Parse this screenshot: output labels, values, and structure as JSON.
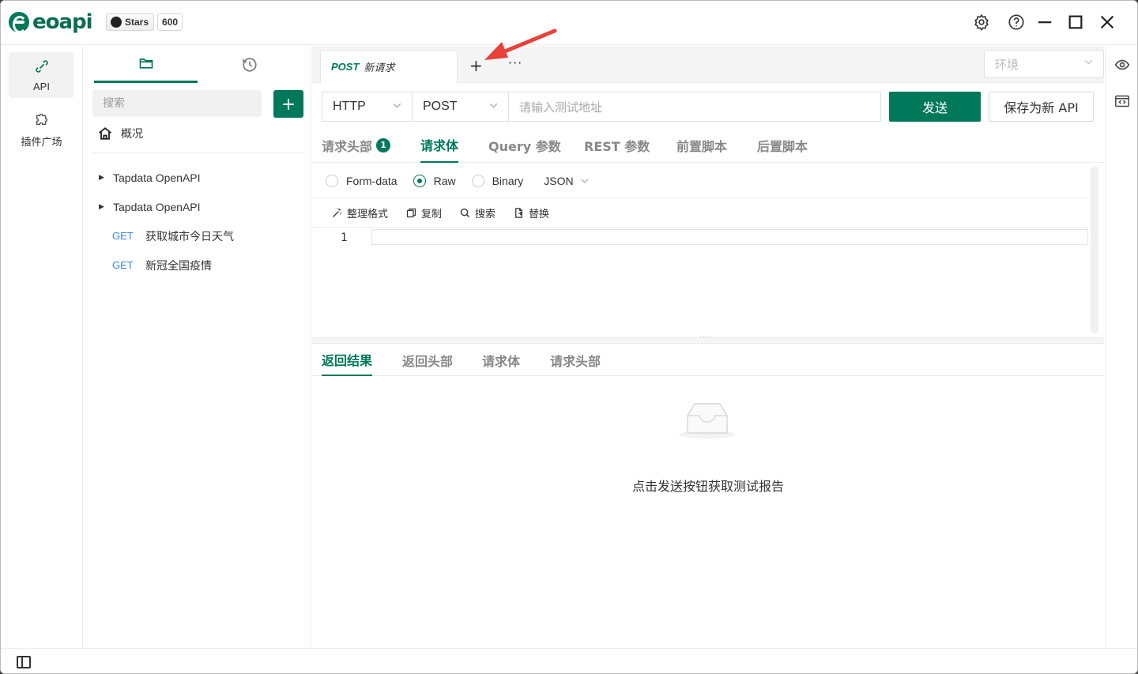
{
  "app": {
    "logo_text": "eoapi",
    "github": {
      "stars_label": "Stars",
      "stars_count": "600"
    },
    "brand_color": "#00785a"
  },
  "window_controls": [
    "settings-icon",
    "help-icon",
    "minimize-icon",
    "maximize-icon",
    "close-icon"
  ],
  "rail": {
    "items": [
      {
        "label": "API",
        "icon": "api-icon",
        "active": true
      },
      {
        "label": "插件广场",
        "icon": "plugin-icon",
        "active": false
      }
    ]
  },
  "sidebar": {
    "tabs": [
      {
        "icon": "folder-icon",
        "active": true
      },
      {
        "icon": "history-icon",
        "active": false
      }
    ],
    "search_placeholder": "搜索",
    "overview_label": "概况",
    "tree": [
      {
        "type": "group",
        "label": "Tapdata OpenAPI"
      },
      {
        "type": "group",
        "label": "Tapdata OpenAPI"
      },
      {
        "type": "api",
        "method": "GET",
        "label": "获取城市今日天气"
      },
      {
        "type": "api",
        "method": "GET",
        "label": "新冠全国疫情"
      }
    ]
  },
  "tabbar": {
    "active_tab": {
      "method": "POST",
      "title": "新请求"
    },
    "add_label": "+",
    "more_label": "···",
    "env_placeholder": "环境"
  },
  "request": {
    "protocol": "HTTP",
    "method": "POST",
    "url_placeholder": "请输入测试地址",
    "send_label": "发送",
    "save_label": "保存为新 API",
    "tabs": [
      {
        "label": "请求头部",
        "badge": "1",
        "active": false
      },
      {
        "label": "请求体",
        "active": true
      },
      {
        "label": "Query 参数",
        "active": false
      },
      {
        "label": "REST 参数",
        "active": false
      },
      {
        "label": "前置脚本",
        "active": false
      },
      {
        "label": "后置脚本",
        "active": false
      }
    ],
    "body_types": [
      {
        "label": "Form-data",
        "checked": false
      },
      {
        "label": "Raw",
        "checked": true
      },
      {
        "label": "Binary",
        "checked": false
      }
    ],
    "raw_format": "JSON",
    "editor_tools": [
      {
        "label": "整理格式",
        "icon": "wand-icon"
      },
      {
        "label": "复制",
        "icon": "copy-icon"
      },
      {
        "label": "搜索",
        "icon": "search-icon"
      },
      {
        "label": "替换",
        "icon": "replace-icon"
      }
    ],
    "line_number": "1"
  },
  "response": {
    "tabs": [
      {
        "label": "返回结果",
        "active": true
      },
      {
        "label": "返回头部",
        "active": false
      },
      {
        "label": "请求体",
        "active": false
      },
      {
        "label": "请求头部",
        "active": false
      }
    ],
    "empty_text": "点击发送按钮获取测试报告"
  },
  "right_rail": [
    "eye-icon",
    "code-icon"
  ]
}
